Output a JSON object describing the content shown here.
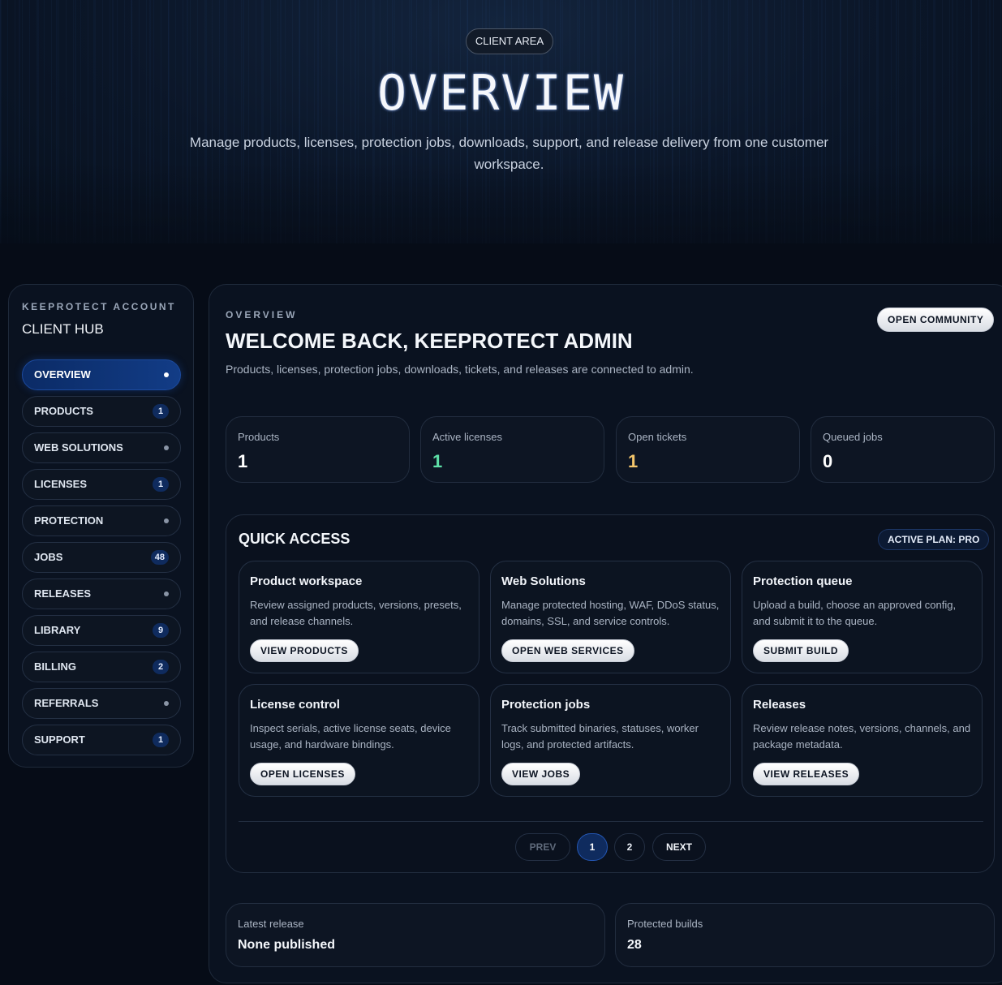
{
  "hero": {
    "pill": "CLIENT AREA",
    "title": "OVERVIEW",
    "subtitle": "Manage products, licenses, protection jobs, downloads, support, and release delivery from one customer workspace."
  },
  "sidebar": {
    "kicker": "KEEPROTECT ACCOUNT",
    "title": "CLIENT HUB",
    "items": [
      {
        "label": "OVERVIEW",
        "badge": null,
        "active": true
      },
      {
        "label": "PRODUCTS",
        "badge": "1"
      },
      {
        "label": "WEB SOLUTIONS",
        "badge": null
      },
      {
        "label": "LICENSES",
        "badge": "1"
      },
      {
        "label": "PROTECTION",
        "badge": null
      },
      {
        "label": "JOBS",
        "badge": "48"
      },
      {
        "label": "RELEASES",
        "badge": null
      },
      {
        "label": "LIBRARY",
        "badge": "9"
      },
      {
        "label": "BILLING",
        "badge": "2"
      },
      {
        "label": "REFERRALS",
        "badge": null
      },
      {
        "label": "SUPPORT",
        "badge": "1"
      }
    ]
  },
  "main": {
    "kicker": "OVERVIEW",
    "title": "WELCOME BACK, KEEPROTECT ADMIN",
    "subtitle": "Products, licenses, protection jobs, downloads, tickets, and releases are connected to admin.",
    "community_button": "OPEN COMMUNITY",
    "stats": [
      {
        "label": "Products",
        "value": "1",
        "color": "#ffffff"
      },
      {
        "label": "Active licenses",
        "value": "1",
        "color": "#5ee0a8"
      },
      {
        "label": "Open tickets",
        "value": "1",
        "color": "#f3c56b"
      },
      {
        "label": "Queued jobs",
        "value": "0",
        "color": "#ffffff"
      }
    ]
  },
  "quick_access": {
    "title": "QUICK ACCESS",
    "plan_badge": "ACTIVE PLAN: PRO",
    "cards": [
      {
        "title": "Product workspace",
        "desc": "Review assigned products, versions, presets, and release channels.",
        "button": "VIEW PRODUCTS"
      },
      {
        "title": "Web Solutions",
        "desc": "Manage protected hosting, WAF, DDoS status, domains, SSL, and service controls.",
        "button": "OPEN WEB SERVICES"
      },
      {
        "title": "Protection queue",
        "desc": "Upload a build, choose an approved config, and submit it to the queue.",
        "button": "SUBMIT BUILD"
      },
      {
        "title": "License control",
        "desc": "Inspect serials, active license seats, device usage, and hardware bindings.",
        "button": "OPEN LICENSES"
      },
      {
        "title": "Protection jobs",
        "desc": "Track submitted binaries, statuses, worker logs, and protected artifacts.",
        "button": "VIEW JOBS"
      },
      {
        "title": "Releases",
        "desc": "Review release notes, versions, channels, and package metadata.",
        "button": "VIEW RELEASES"
      }
    ],
    "pagination": {
      "prev": "PREV",
      "pages": [
        "1",
        "2"
      ],
      "current": "1",
      "next": "NEXT"
    }
  },
  "bottom": [
    {
      "label": "Latest release",
      "value": "None published"
    },
    {
      "label": "Protected builds",
      "value": "28"
    }
  ]
}
